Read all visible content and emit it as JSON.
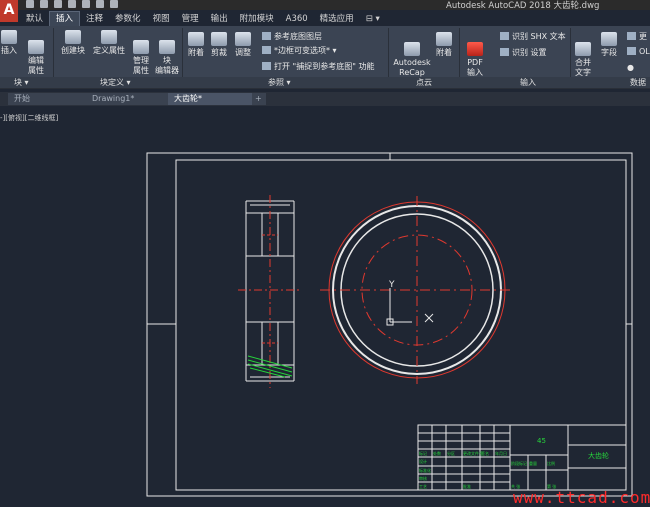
{
  "window": {
    "title": "Autodesk AutoCAD 2018    大齿轮.dwg",
    "app_button": "A"
  },
  "ribbon_tabs": [
    "默认",
    "插入",
    "注释",
    "参数化",
    "视图",
    "管理",
    "输出",
    "附加模块",
    "A360",
    "精选应用",
    "⊟ ▾"
  ],
  "active_ribbon_tab": "插入",
  "ribbon": {
    "insert": "插入",
    "edit_attr": "编辑\n属性",
    "create_block": "创建块",
    "define_attr": "定义属性",
    "manage_attr": "管理\n属性",
    "block_editor": "块\n编辑器",
    "attach": "附着",
    "clip": "剪裁",
    "adjust": "调整",
    "underlay_layers": "参考底图图层",
    "frames": "*边框可变选项*",
    "snap": "捕捉到参考底图",
    "snap_state": "功能",
    "recap": "Autodesk\nReCap",
    "attach2": "附着",
    "pdf_import": "PDF\n输入",
    "shx_text": "识别 SHX 文本",
    "recog_settings": "识别 设置",
    "combine_text": "合并\n文字",
    "field": "字段",
    "more1": "更",
    "more2": "OL",
    "more3": "●"
  },
  "panels": {
    "block": "块 ▾",
    "block_def": "块定义 ▾",
    "reference": "参照 ▾",
    "point_cloud": "点云",
    "import": "输入",
    "data": "数据"
  },
  "file_tabs": [
    "开始",
    "Drawing1*",
    "大齿轮*"
  ],
  "active_file_tab": "大齿轮*",
  "viewport_label": "-][俯视][二维线框]",
  "title_block": {
    "name_label": "大齿轮",
    "material": "45",
    "cells": [
      "标记",
      "处数",
      "分区",
      "更改文件号",
      "签名",
      "年月日",
      "阶段标记",
      "重量",
      "比例",
      "设计",
      "标准化",
      "审核",
      "工艺",
      "批准",
      "共 张",
      "第 张"
    ]
  },
  "ucs": {
    "y": "Y"
  },
  "watermark": "www.ttcad.com",
  "colors": {
    "bg": "#1f2633",
    "red": "#e0392f",
    "green": "#26d43b",
    "white": "#e8e8e8"
  }
}
